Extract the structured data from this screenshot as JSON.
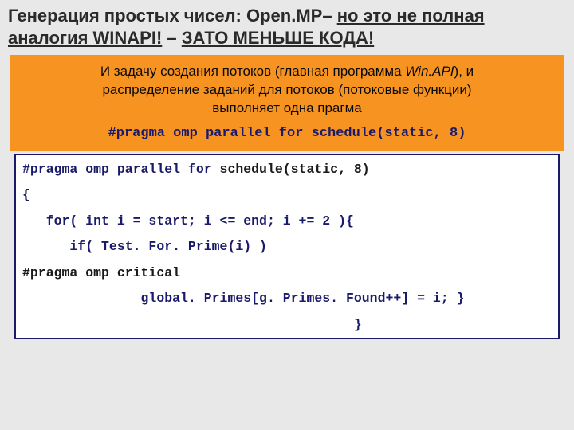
{
  "title": {
    "part1": "Генерация простых чисел:  Open.MP",
    "dash1": "– ",
    "underlined1": "но это не полная аналогия WINAPI!",
    "dash2": " – ",
    "underlined2": "ЗАТО МЕНЬШЕ КОДА!"
  },
  "banner": {
    "line1a": "И задачу создания потоков (главная программа ",
    "line1b_ital": "Win.API",
    "line1c": "), и",
    "line2": "распределение заданий для потоков (потоковые функции)",
    "line3": "выполняет  одна прагма",
    "code": "#pragma omp parallel for schedule(static, 8)"
  },
  "code": {
    "l1_a": "#pragma omp parallel for ",
    "l1_b": "schedule(static, 8)",
    "l2": "{",
    "l3": "   for( int i = start; i <= end; i += 2 ){",
    "l4": "      if( Test. For. Prime(i) )",
    "l5": "#pragma omp critical",
    "l6": "               global. Primes[g. Primes. Found++] = i; }",
    "l7": "                                          }"
  }
}
